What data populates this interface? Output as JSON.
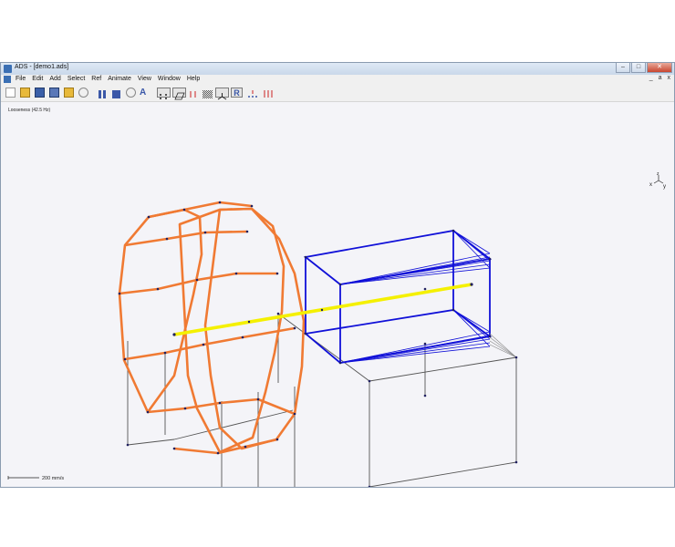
{
  "window": {
    "title": "ADS - [demo1.ads]"
  },
  "menu": [
    "File",
    "Edit",
    "Add",
    "Select",
    "Ref",
    "Animate",
    "View",
    "Window",
    "Help"
  ],
  "mdi_controls": [
    "_",
    "a",
    "x"
  ],
  "toolbar_text": {
    "a_button": "A",
    "r_button": "R"
  },
  "viewport": {
    "mode_label": "Looseness (42.5 Hz)",
    "scale_label": "200 mm/s",
    "axes": {
      "x": "x",
      "y": "y",
      "z": "z"
    }
  },
  "colors": {
    "wheel": "#f07a33",
    "box": "#1010d8",
    "shaft": "#f4f000",
    "support": "#555555",
    "node": "#202060"
  }
}
